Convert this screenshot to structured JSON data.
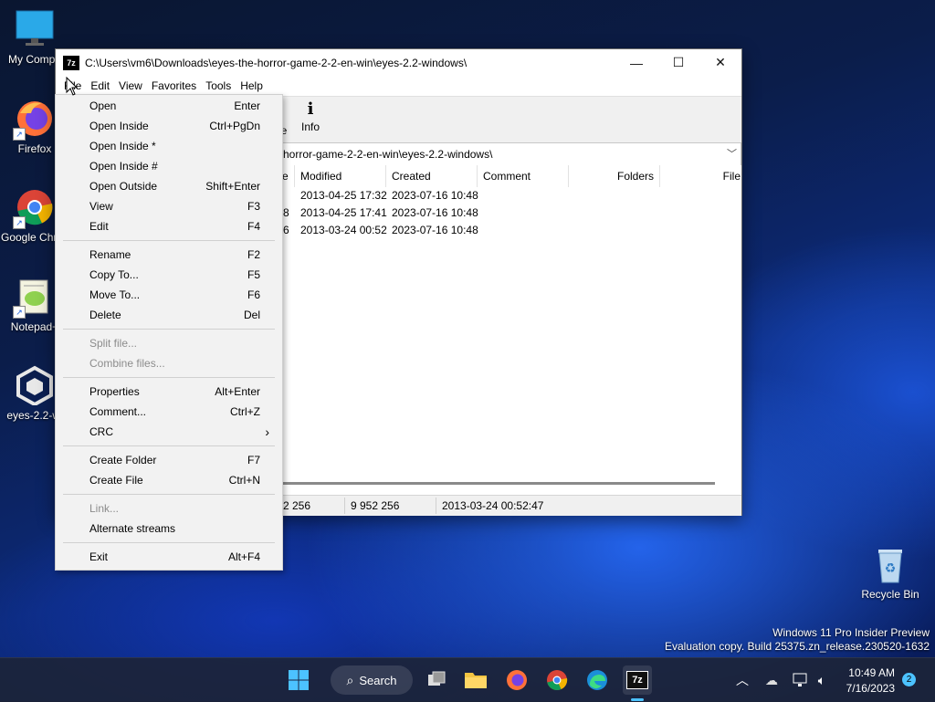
{
  "desktop": {
    "icons": [
      {
        "label": "My Compu"
      },
      {
        "label": "Firefox"
      },
      {
        "label": "Google Chrome"
      },
      {
        "label": "Notepad+"
      },
      {
        "label": "eyes-2.2-wi"
      }
    ],
    "recycle_bin": "Recycle Bin",
    "watermark_line1": "Windows 11 Pro Insider Preview",
    "watermark_line2": "Evaluation copy. Build 25375.zn_release.230520-1632"
  },
  "window": {
    "app_badge": "7z",
    "title": "C:\\Users\\vm6\\Downloads\\eyes-the-horror-game-2-2-en-win\\eyes-2.2-windows\\",
    "controls": {
      "minimize": "—",
      "maximize": "☐",
      "close": "✕"
    },
    "menu": [
      "File",
      "Edit",
      "View",
      "Favorites",
      "Tools",
      "Help"
    ],
    "toolbar": {
      "partial_label": "e",
      "info_label": "Info"
    },
    "address": "horror-game-2-2-en-win\\eyes-2.2-windows\\",
    "columns": {
      "c0": "e",
      "modified": "Modified",
      "created": "Created",
      "comment": "Comment",
      "folders": "Folders",
      "files": "File"
    },
    "rows": [
      {
        "c0": "",
        "modified": "2013-04-25 17:32",
        "created": "2023-07-16 10:48"
      },
      {
        "c0": "8",
        "modified": "2013-04-25 17:41",
        "created": "2023-07-16 10:48"
      },
      {
        "c0": "6",
        "modified": "2013-03-24 00:52",
        "created": "2023-07-16 10:48"
      }
    ],
    "status": {
      "s1": "2 256",
      "s2": "9 952 256",
      "s3": "2013-03-24 00:52:47"
    }
  },
  "file_menu": {
    "groups": [
      [
        {
          "label": "Open",
          "shortcut": "Enter",
          "disabled": false
        },
        {
          "label": "Open Inside",
          "shortcut": "Ctrl+PgDn",
          "disabled": false
        },
        {
          "label": "Open Inside *",
          "shortcut": "",
          "disabled": false
        },
        {
          "label": "Open Inside #",
          "shortcut": "",
          "disabled": false
        },
        {
          "label": "Open Outside",
          "shortcut": "Shift+Enter",
          "disabled": false
        },
        {
          "label": "View",
          "shortcut": "F3",
          "disabled": false
        },
        {
          "label": "Edit",
          "shortcut": "F4",
          "disabled": false
        }
      ],
      [
        {
          "label": "Rename",
          "shortcut": "F2",
          "disabled": false
        },
        {
          "label": "Copy To...",
          "shortcut": "F5",
          "disabled": false
        },
        {
          "label": "Move To...",
          "shortcut": "F6",
          "disabled": false
        },
        {
          "label": "Delete",
          "shortcut": "Del",
          "disabled": false
        }
      ],
      [
        {
          "label": "Split file...",
          "shortcut": "",
          "disabled": true
        },
        {
          "label": "Combine files...",
          "shortcut": "",
          "disabled": true
        }
      ],
      [
        {
          "label": "Properties",
          "shortcut": "Alt+Enter",
          "disabled": false
        },
        {
          "label": "Comment...",
          "shortcut": "Ctrl+Z",
          "disabled": false
        },
        {
          "label": "CRC",
          "shortcut": "›",
          "disabled": false
        }
      ],
      [
        {
          "label": "Create Folder",
          "shortcut": "F7",
          "disabled": false
        },
        {
          "label": "Create File",
          "shortcut": "Ctrl+N",
          "disabled": false
        }
      ],
      [
        {
          "label": "Link...",
          "shortcut": "",
          "disabled": true
        },
        {
          "label": "Alternate streams",
          "shortcut": "",
          "disabled": false
        }
      ],
      [
        {
          "label": "Exit",
          "shortcut": "Alt+F4",
          "disabled": false
        }
      ]
    ]
  },
  "taskbar": {
    "search_label": "Search",
    "active_app_badge": "7z",
    "time": "10:49 AM",
    "date": "7/16/2023",
    "notification_count": "2"
  },
  "colors": {
    "accent": "#0067c0",
    "menu_bg": "#f2f2f2",
    "disabled_text": "#8c8c8c"
  }
}
